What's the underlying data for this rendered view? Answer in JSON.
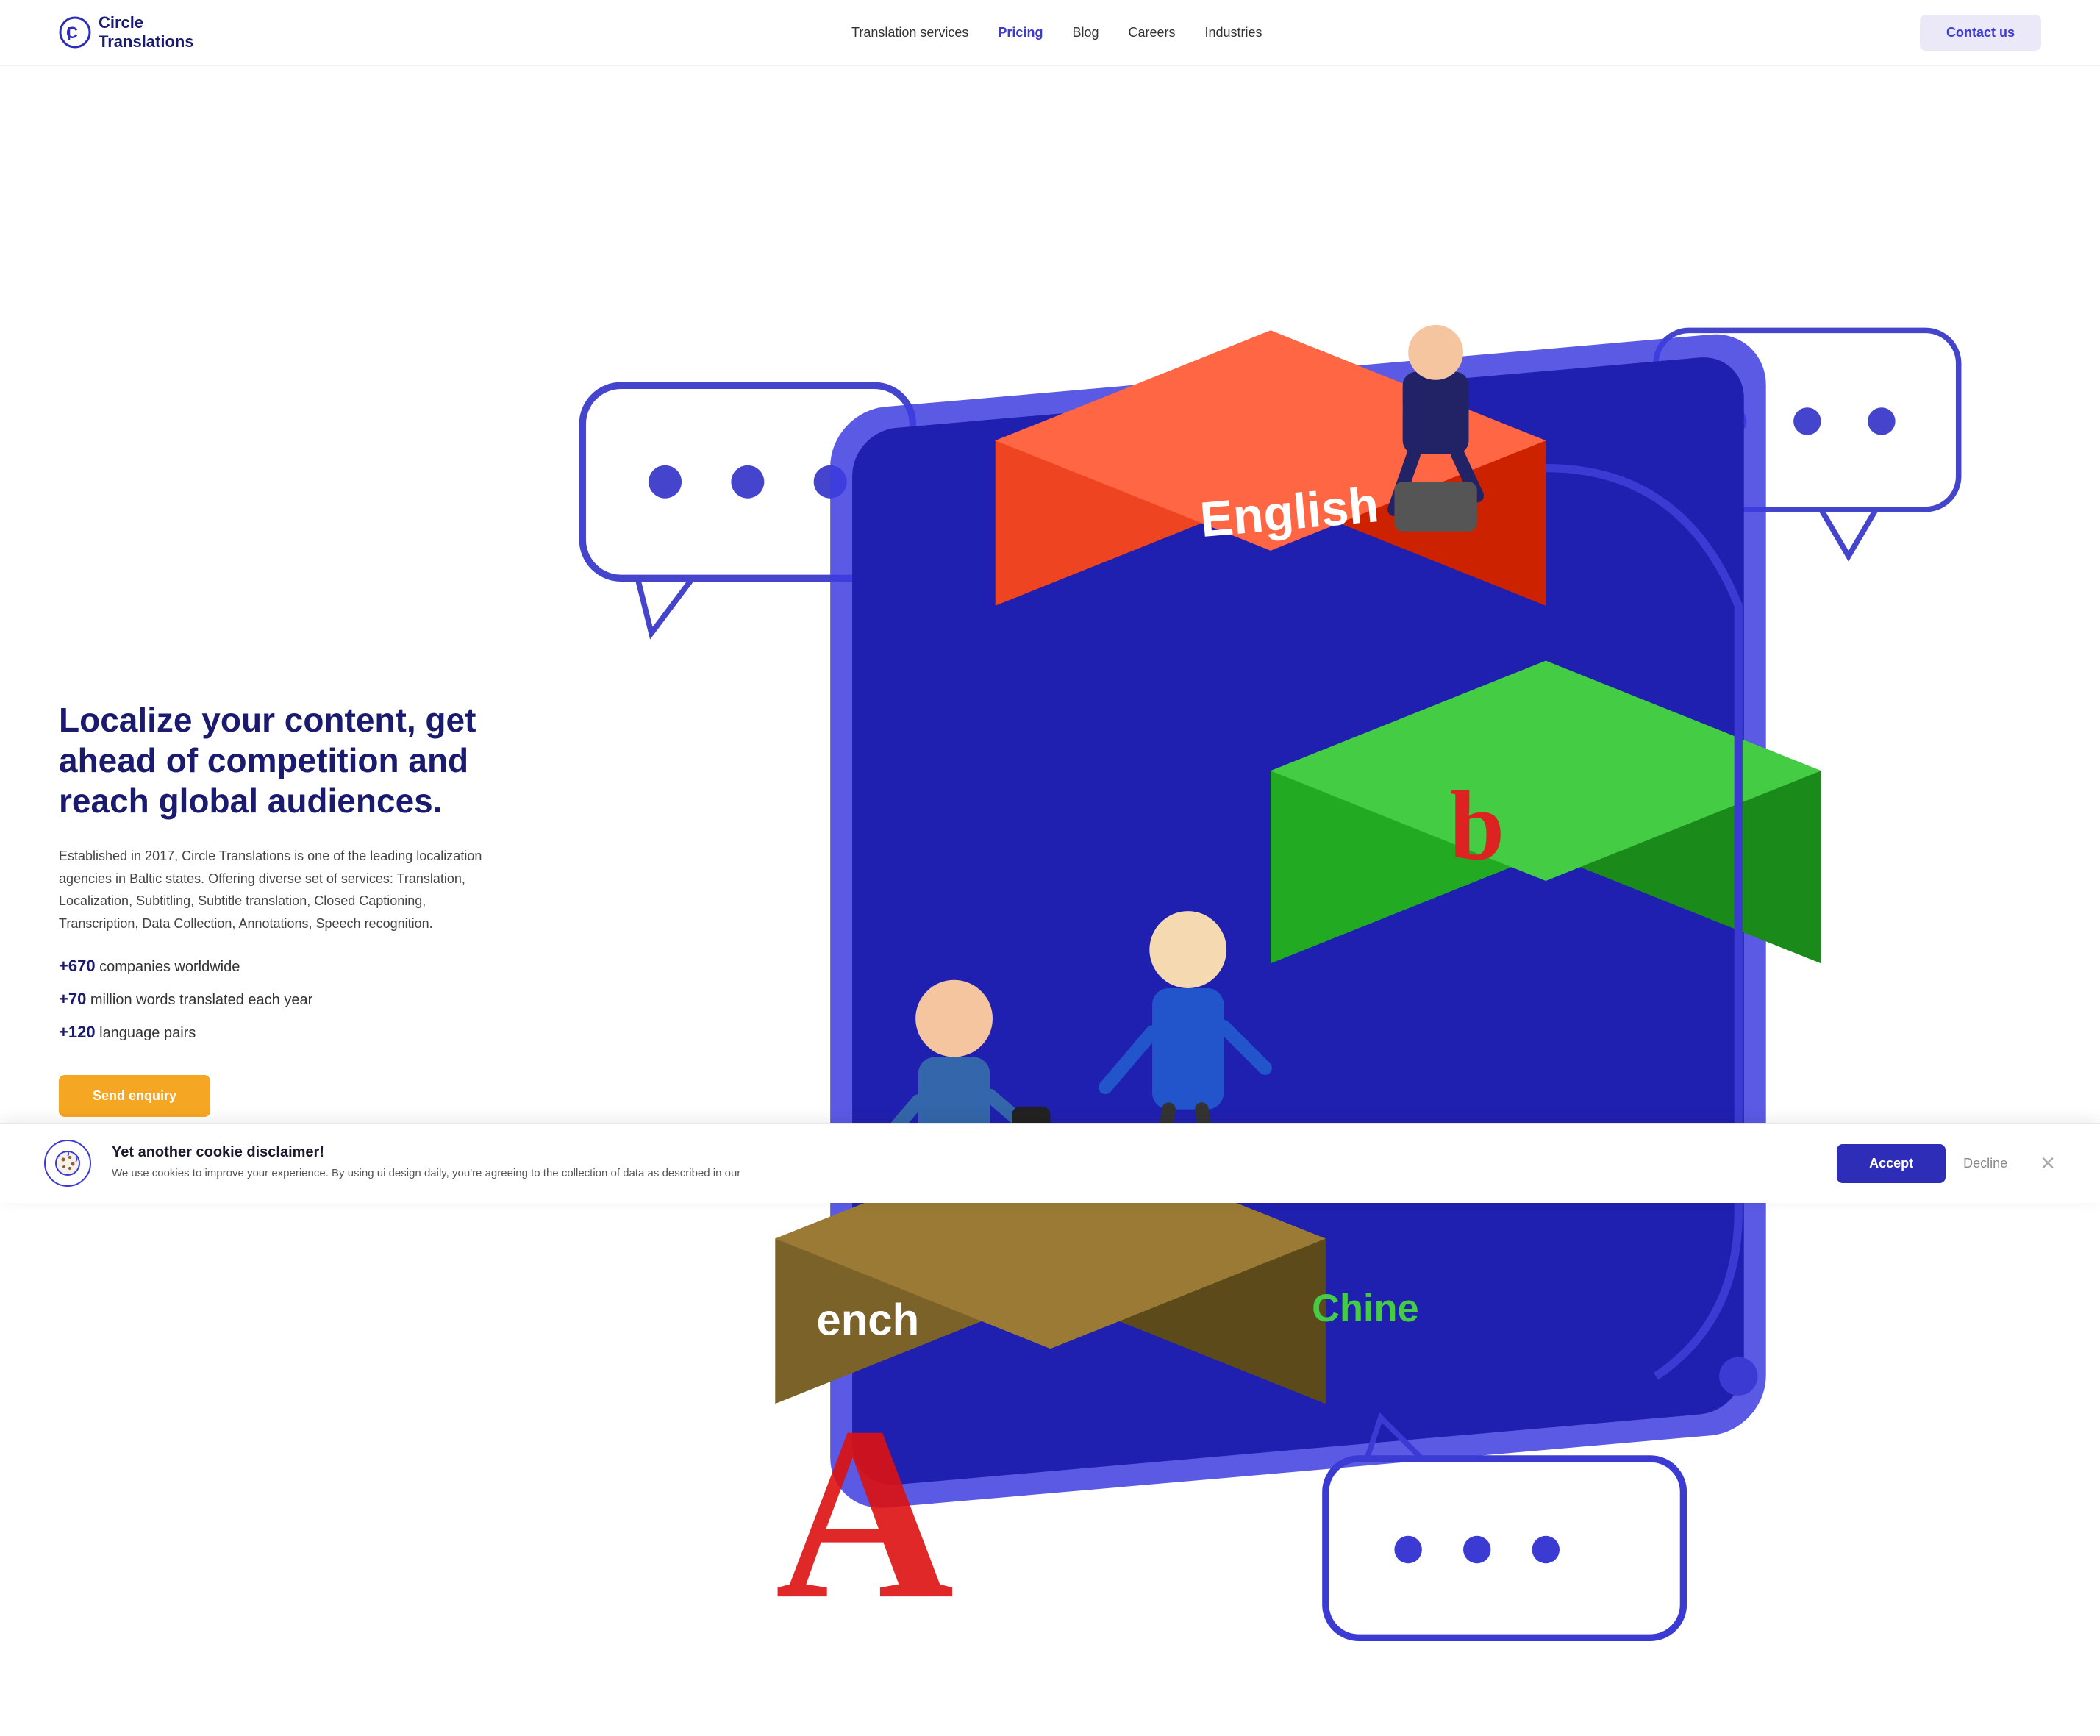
{
  "navbar": {
    "logo_text_line1": "Circle",
    "logo_text_line2": "Translations",
    "links": [
      {
        "label": "Translation services",
        "active": false,
        "name": "translation-services-link"
      },
      {
        "label": "Pricing",
        "active": true,
        "name": "pricing-link"
      },
      {
        "label": "Blog",
        "active": false,
        "name": "blog-link"
      },
      {
        "label": "Careers",
        "active": false,
        "name": "careers-link"
      },
      {
        "label": "Industries",
        "active": false,
        "name": "industries-link"
      }
    ],
    "contact_button": "Contact us"
  },
  "hero": {
    "title": "Localize your content, get ahead of competition and reach global audiences.",
    "description": "Established in 2017, Circle Translations is one of the leading localization agencies in Baltic states. Offering diverse set of services: Translation, Localization, Subtitling, Subtitle translation, Closed Captioning, Transcription, Data Collection, Annotations, Speech recognition.",
    "stats": [
      {
        "bold": "+670",
        "text": " companies worldwide"
      },
      {
        "bold": "+70",
        "text": " million words translated each year"
      },
      {
        "bold": "+120",
        "text": " language pairs"
      }
    ],
    "cta_button": "Send enquiry"
  },
  "cookie": {
    "title": "Yet another cookie disclaimer!",
    "description": "We use cookies to improve your experience. By using ui design daily, you're agreeing to the collection of data as described in our",
    "accept_label": "Accept",
    "decline_label": "Decline"
  }
}
